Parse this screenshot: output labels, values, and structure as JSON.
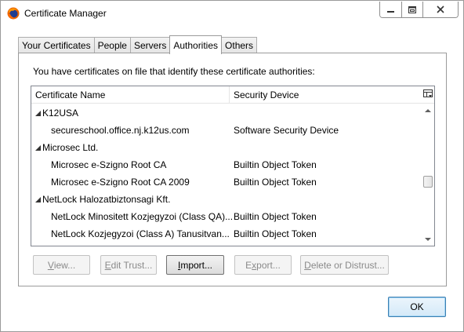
{
  "window": {
    "title": "Certificate Manager",
    "controls": {
      "minimize": "—",
      "restore": "□",
      "close": "✕"
    }
  },
  "tabs": [
    {
      "label": "Your Certificates",
      "active": false
    },
    {
      "label": "People",
      "active": false
    },
    {
      "label": "Servers",
      "active": false
    },
    {
      "label": "Authorities",
      "active": true
    },
    {
      "label": "Others",
      "active": false
    }
  ],
  "panel": {
    "intro": "You have certificates on file that identify these certificate authorities:"
  },
  "tree": {
    "columns": {
      "name": "Certificate Name",
      "device": "Security Device"
    },
    "rows": [
      {
        "type": "group",
        "name": "K12USA",
        "device": ""
      },
      {
        "type": "cert",
        "name": "secureschool.office.nj.k12us.com",
        "device": "Software Security Device"
      },
      {
        "type": "group",
        "name": "Microsec Ltd.",
        "device": ""
      },
      {
        "type": "cert",
        "name": "Microsec e-Szigno Root CA",
        "device": "Builtin Object Token"
      },
      {
        "type": "cert",
        "name": "Microsec e-Szigno Root CA 2009",
        "device": "Builtin Object Token"
      },
      {
        "type": "group",
        "name": "NetLock Halozatbiztonsagi Kft.",
        "device": ""
      },
      {
        "type": "cert",
        "name": "NetLock Minositett Kozjegyzoi (Class QA)...",
        "device": "Builtin Object Token"
      },
      {
        "type": "cert",
        "name": "NetLock Kozjegyzoi (Class A) Tanusitvan...",
        "device": "Builtin Object Token"
      }
    ],
    "scroll_position": 0.5
  },
  "buttons": {
    "view": {
      "mnemonic": "V",
      "rest": "iew..."
    },
    "edit_trust": {
      "mnemonic": "E",
      "rest": "dit Trust..."
    },
    "import": {
      "mnemonic": "I",
      "rest": "mport..."
    },
    "export": {
      "mnemonic": "x",
      "pre": "E",
      "rest": "port..."
    },
    "delete": {
      "mnemonic": "D",
      "rest": "elete or Distrust..."
    },
    "ok": "OK"
  },
  "icons": {
    "app": "firefox-icon",
    "expanded": "expanded-triangle-icon",
    "column_picker": "column-picker-icon"
  },
  "colors": {
    "ok_border": "#3c7fb1",
    "disabled_text": "#8a8a8a"
  }
}
